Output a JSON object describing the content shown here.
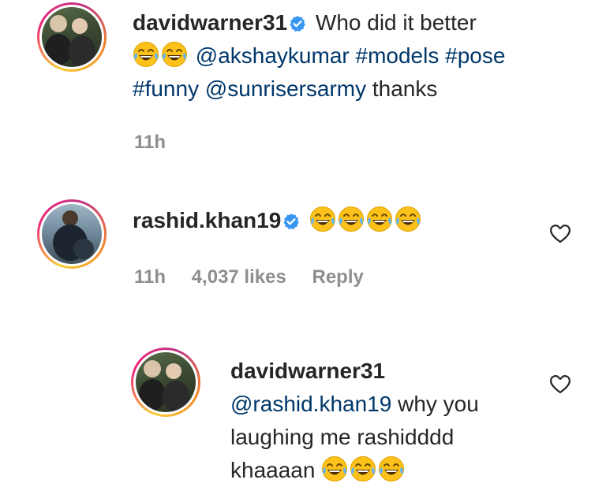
{
  "comments": [
    {
      "username": "davidwarner31",
      "text_1": "Who did it better",
      "mention_1": "@akshaykumar",
      "tag_1": "#models",
      "tag_2": "#pose",
      "tag_3": "#funny",
      "mention_2": "@sunrisersarmy",
      "text_2": "thanks",
      "emoji": "face-with-tears-of-joy",
      "time": "11h"
    },
    {
      "username": "rashid.khan19",
      "emoji": "face-with-tears-of-joy",
      "time": "11h",
      "likes": "4,037 likes",
      "reply_label": "Reply"
    },
    {
      "username": "davidwarner31",
      "mention": "@rashid.khan19",
      "text_1": "why you",
      "text_2": "laughing me rashidddd",
      "text_3": "khaaaan",
      "emoji": "face-with-tears-of-joy"
    }
  ],
  "icons": {
    "verified": "verified-badge-icon",
    "like": "heart-icon"
  },
  "colors": {
    "link": "#00376b",
    "meta": "#8e8e8e",
    "verified": "#3897f0"
  }
}
